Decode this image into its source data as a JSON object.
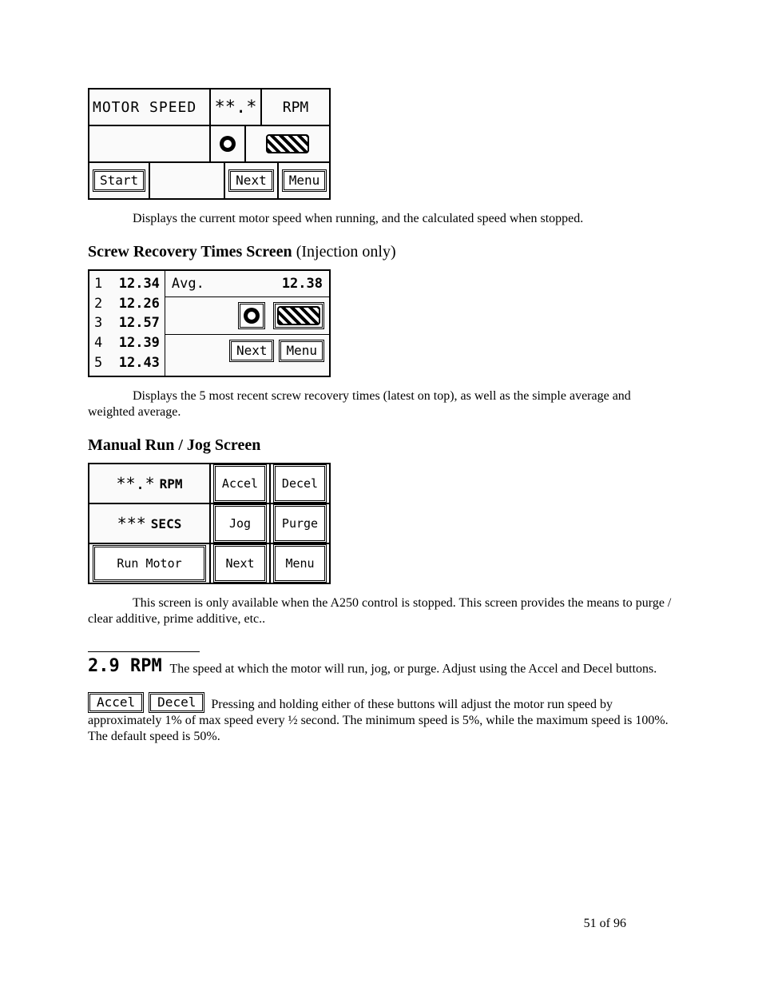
{
  "motor_panel": {
    "label": "MOTOR SPEED",
    "value_placeholder": "**.*",
    "unit": "RPM",
    "start_btn": "Start",
    "next_btn": "Next",
    "menu_btn": "Menu"
  },
  "motor_caption": "Displays the current motor speed when running, and the calculated speed when stopped.",
  "recovery_heading_bold": "Screw Recovery  Times Screen ",
  "recovery_heading_plain": "(Injection only)",
  "recovery_panel": {
    "rows": [
      {
        "idx": "1",
        "val": "12.34"
      },
      {
        "idx": "2",
        "val": "12.26"
      },
      {
        "idx": "3",
        "val": "12.57"
      },
      {
        "idx": "4",
        "val": "12.39"
      },
      {
        "idx": "5",
        "val": "12.43"
      }
    ],
    "avg_label": "Avg.",
    "avg_value": "12.38",
    "next_btn": "Next",
    "menu_btn": "Menu"
  },
  "recovery_caption": "Displays the 5 most recent screw recovery times (latest on top), as well as the simple average and weighted average.",
  "jog_heading": "Manual Run / Jog Screen",
  "jog_panel": {
    "rpm_placeholder": "**.*",
    "rpm_unit": "RPM",
    "secs_placeholder": "***",
    "secs_unit": "SECS",
    "accel_btn": "Accel",
    "decel_btn": "Decel",
    "jog_btn": "Jog",
    "purge_btn": "Purge",
    "run_btn": "Run Motor",
    "next_btn": "Next",
    "menu_btn": "Menu"
  },
  "jog_caption": "This screen is only available when the A250 control is stopped. This screen provides the means to purge / clear additive, prime additive, etc..",
  "rpm_callout": "2.9 RPM",
  "rpm_para_tail": "The speed at which the motor will run, jog, or purge. Adjust using the Accel and Decel buttons.",
  "accel_decel_btns": {
    "accel": "Accel",
    "decel": "Decel"
  },
  "accel_decel_para_tail": "Pressing and holding either of these buttons will adjust the motor run speed by approximately 1% of max speed every ½ second. The minimum speed is 5%, while the maximum speed is 100%. The default speed is 50%.",
  "page_number": "51 of 96"
}
